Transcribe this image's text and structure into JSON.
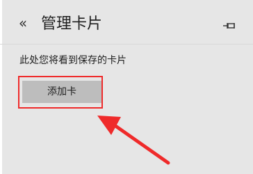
{
  "header": {
    "back_glyph": "«",
    "title": "管理卡片"
  },
  "content": {
    "info_text": "此处您将看到保存的卡片",
    "add_card_label": "添加卡"
  },
  "annotation": {
    "highlight_color": "#ef2a2a",
    "arrow_color": "#ef2a2a"
  },
  "icons": {
    "back": "back-icon",
    "pin": "pin-icon"
  }
}
